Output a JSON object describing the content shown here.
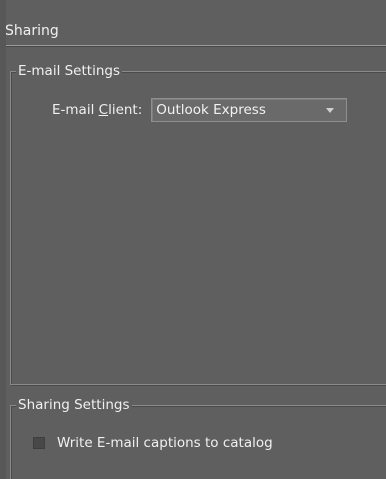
{
  "header": {
    "title": "Sharing"
  },
  "email_settings": {
    "legend": "E-mail Settings",
    "client_label_prefix": "E-mail ",
    "client_label_mnemonic": "C",
    "client_label_suffix": "lient:",
    "client_value": "Outlook Express"
  },
  "sharing_settings": {
    "legend": "Sharing Settings",
    "write_captions_label": "Write E-mail captions to catalog",
    "write_captions_checked": false
  },
  "colors": {
    "panel_background": "#5f5f5f",
    "text": "#f0f0f0",
    "frame_line": "#8a8a8a"
  }
}
